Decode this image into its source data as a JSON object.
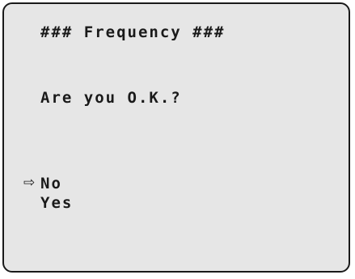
{
  "screen": {
    "title": "### Frequency ###",
    "prompt": "Are you O.K.?",
    "cursor_glyph": "⇨",
    "cursor_icon": "hollow-right-arrow-icon",
    "selected_option": "No",
    "options": [
      {
        "label": "No"
      },
      {
        "label": "Yes"
      }
    ]
  }
}
